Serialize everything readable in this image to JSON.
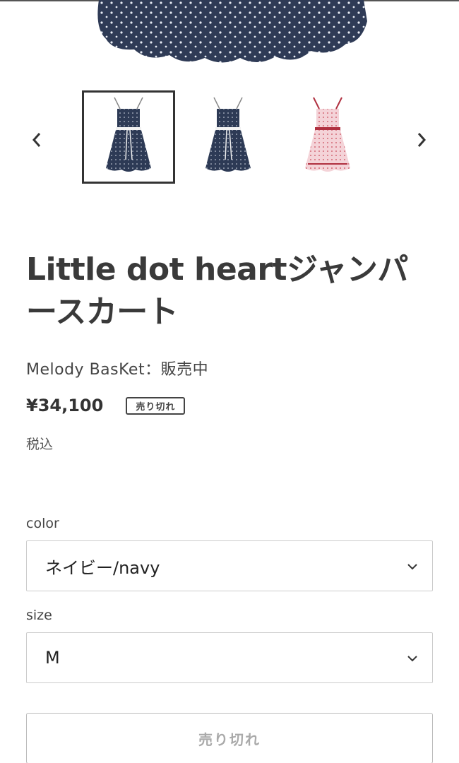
{
  "product": {
    "title": "Little dot heartジャンパースカート",
    "vendor_line": "Melody BasKet：販売中",
    "price": "¥34,100",
    "sold_out_badge": "売り切れ",
    "tax_note": "税込"
  },
  "gallery": {
    "prev_icon": "chevron-left-icon",
    "next_icon": "chevron-right-icon",
    "thumbnails": [
      {
        "color": "navy",
        "fill": "#2d3a55",
        "active": true
      },
      {
        "color": "navy",
        "fill": "#2d3a55",
        "active": false
      },
      {
        "color": "pink",
        "fill": "#f2cdd2",
        "active": false
      }
    ]
  },
  "options": {
    "color_label": "color",
    "color_value": "ネイビー/navy",
    "size_label": "size",
    "size_value": "M"
  },
  "cart": {
    "button_label": "売り切れ"
  },
  "colors": {
    "text": "#333333",
    "border": "#cccccc",
    "disabled_text": "#aaaaaa",
    "navy_fabric": "#2d3a55"
  }
}
